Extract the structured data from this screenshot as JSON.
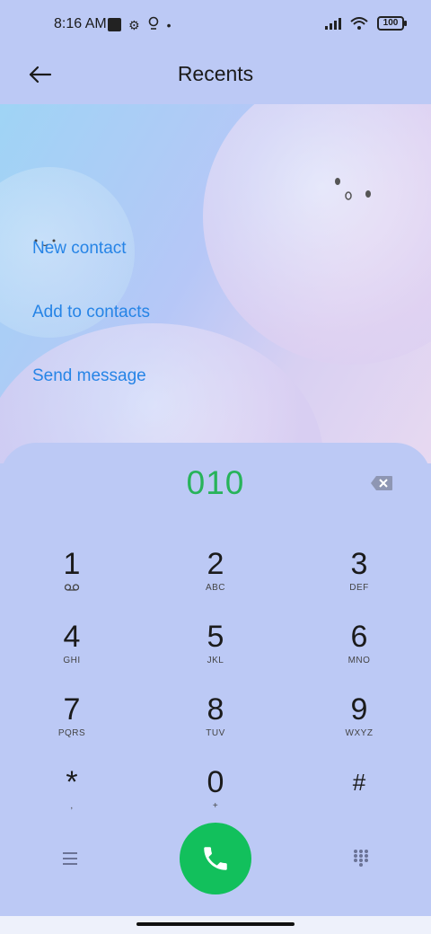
{
  "status_bar": {
    "time": "8:16 AM",
    "battery": "100",
    "icons": [
      "square-icon",
      "gear-icon",
      "location-icon",
      "dot-icon",
      "signal-icon",
      "wifi-icon",
      "battery-icon"
    ]
  },
  "header": {
    "title": "Recents"
  },
  "options": {
    "new_contact": "New contact",
    "add_to_contacts": "Add to contacts",
    "send_message": "Send message"
  },
  "dialer": {
    "number": "010",
    "keys": [
      {
        "digit": "1",
        "letters": "ꝏ"
      },
      {
        "digit": "2",
        "letters": "ABC"
      },
      {
        "digit": "3",
        "letters": "DEF"
      },
      {
        "digit": "4",
        "letters": "GHI"
      },
      {
        "digit": "5",
        "letters": "JKL"
      },
      {
        "digit": "6",
        "letters": "MNO"
      },
      {
        "digit": "7",
        "letters": "PQRS"
      },
      {
        "digit": "8",
        "letters": "TUV"
      },
      {
        "digit": "9",
        "letters": "WXYZ"
      },
      {
        "digit": "*",
        "letters": ","
      },
      {
        "digit": "0",
        "letters": "+"
      },
      {
        "digit": "#",
        "letters": ""
      }
    ]
  },
  "colors": {
    "background": "#bcc9f5",
    "accent_link": "#2684e6",
    "number_green": "#27b35a",
    "call_green": "#12c05c"
  }
}
